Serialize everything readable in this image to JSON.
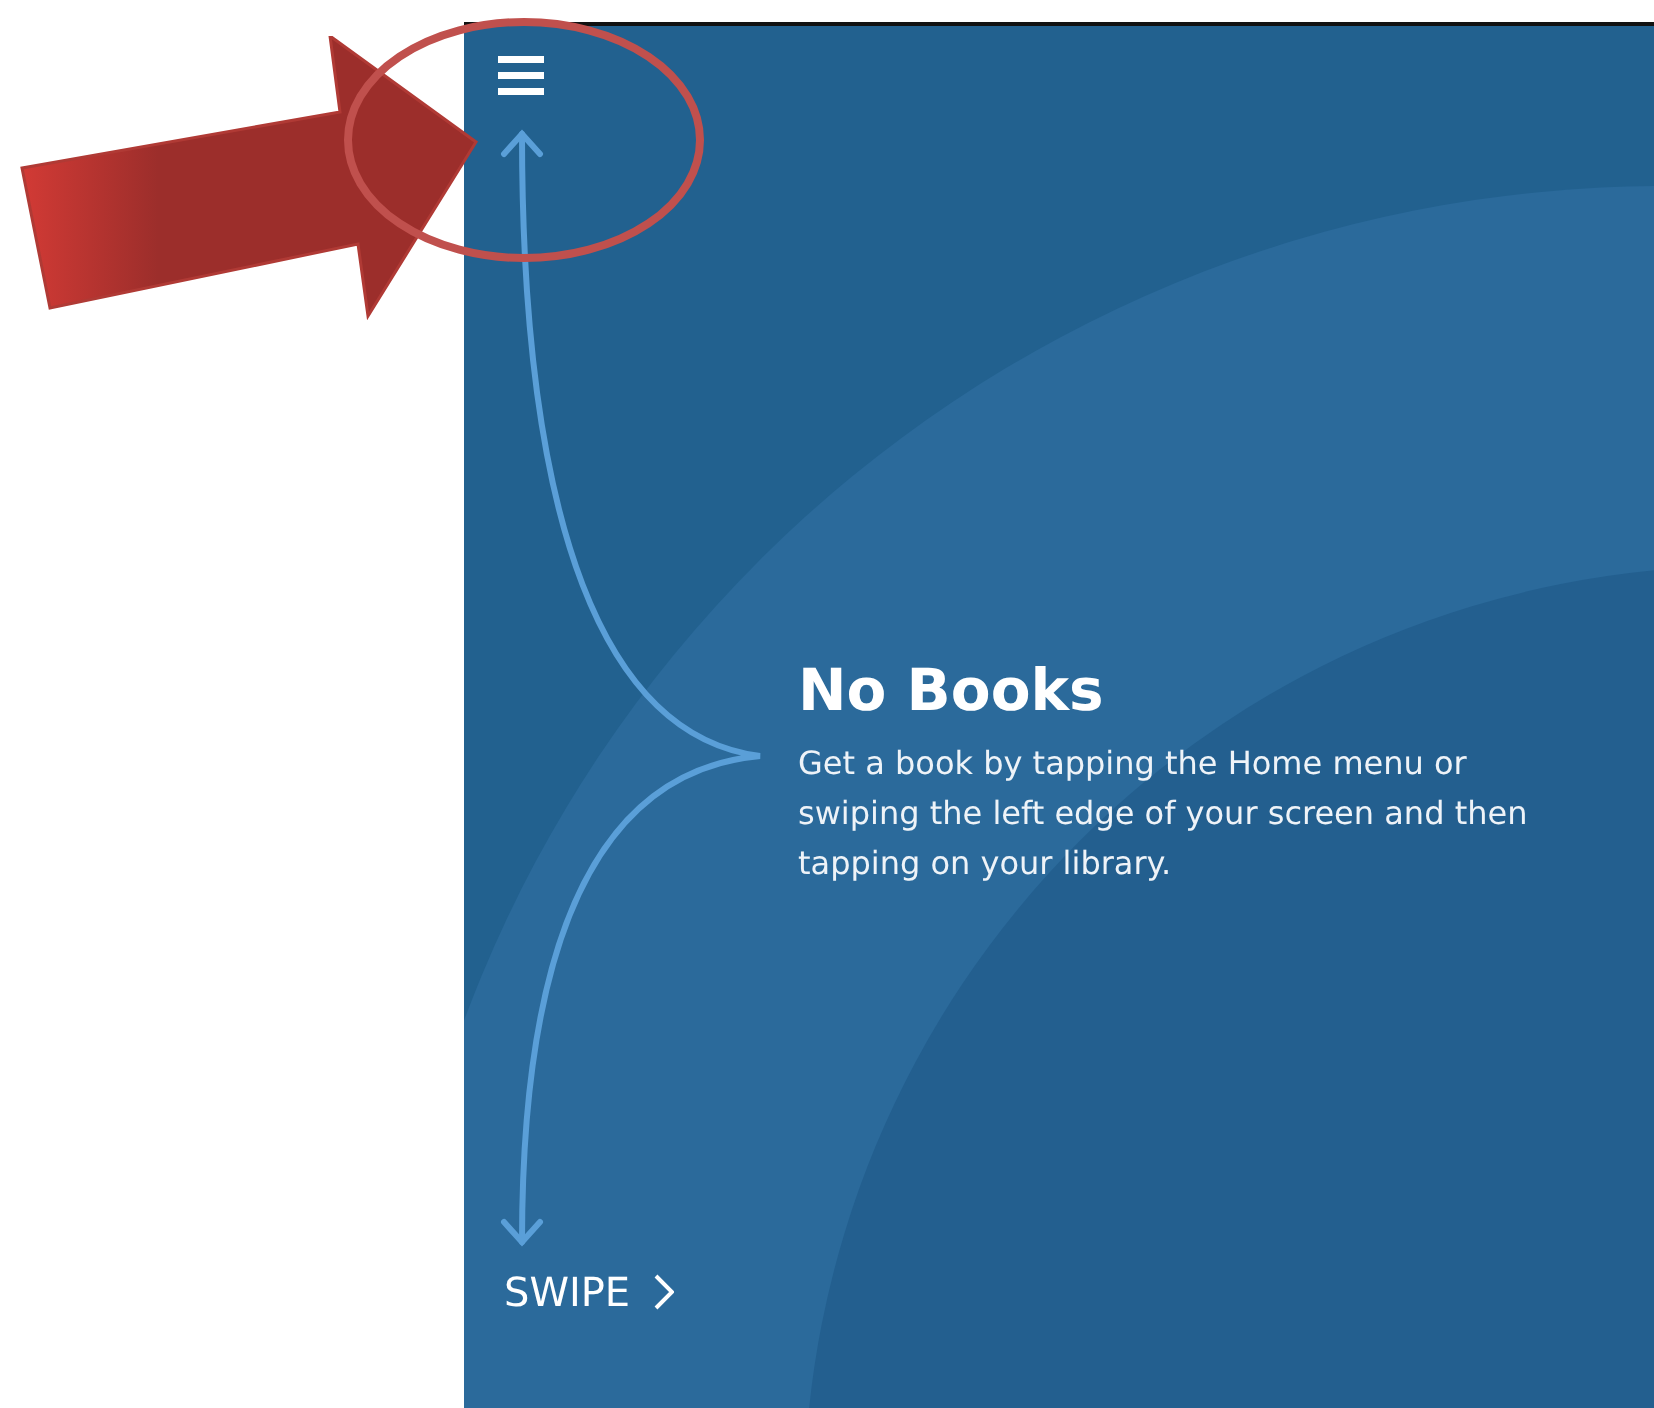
{
  "empty_state": {
    "title": "No Books",
    "message": "Get a book by tapping the Home menu or swiping the left edge of your screen and then tapping on your library."
  },
  "swipe_hint": {
    "label": "SWIPE"
  }
}
